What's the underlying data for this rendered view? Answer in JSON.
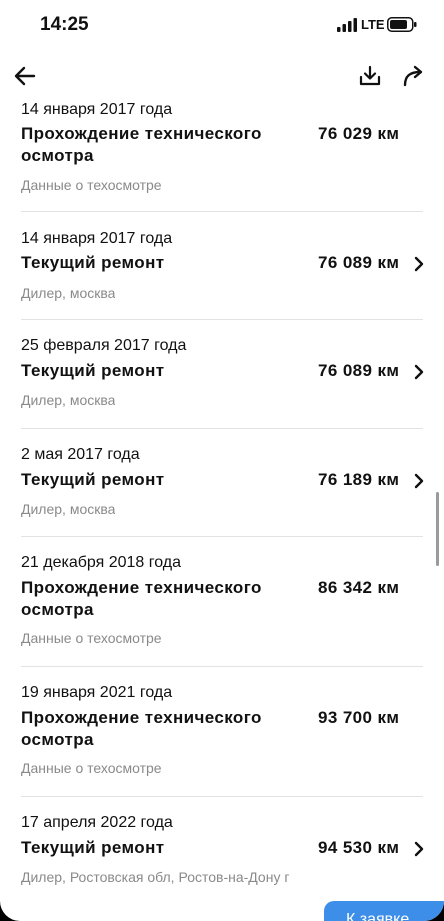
{
  "status_bar": {
    "time": "14:25",
    "network": "LTE"
  },
  "toolbar": {
    "back_icon": "arrow-left-icon",
    "download_icon": "download-icon",
    "share_icon": "share-arrow-icon"
  },
  "records": [
    {
      "date": "14 января 2017 года",
      "title": "Прохождение технического осмотра",
      "km": "76 029 км",
      "subtitle": "Данные о техосмотре",
      "has_chevron": false
    },
    {
      "date": "14 января 2017 года",
      "title": "Текущий ремонт",
      "km": "76 089 км",
      "subtitle": "Дилер, москва",
      "has_chevron": true
    },
    {
      "date": "25 февраля 2017 года",
      "title": "Текущий ремонт",
      "km": "76 089 км",
      "subtitle": "Дилер, москва",
      "has_chevron": true
    },
    {
      "date": "2 мая 2017 года",
      "title": "Текущий ремонт",
      "km": "76 189 км",
      "subtitle": "Дилер, москва",
      "has_chevron": true
    },
    {
      "date": "21 декабря 2018 года",
      "title": "Прохождение технического осмотра",
      "km": "86 342 км",
      "subtitle": "Данные о техосмотре",
      "has_chevron": false
    },
    {
      "date": "19 января 2021 года",
      "title": "Прохождение технического осмотра",
      "km": "93 700 км",
      "subtitle": "Данные о техосмотре",
      "has_chevron": false
    },
    {
      "date": "17 апреля 2022 года",
      "title": "Текущий ремонт",
      "km": "94 530 км",
      "subtitle": "Дилер, Ростовская обл, Ростов-на-Дону г",
      "has_chevron": true
    }
  ],
  "fab": {
    "label": "К заявке"
  },
  "colors": {
    "accent": "#3d8ee8",
    "text": "#111111",
    "muted": "#8a8a8a",
    "divider": "#e3e3e3"
  }
}
